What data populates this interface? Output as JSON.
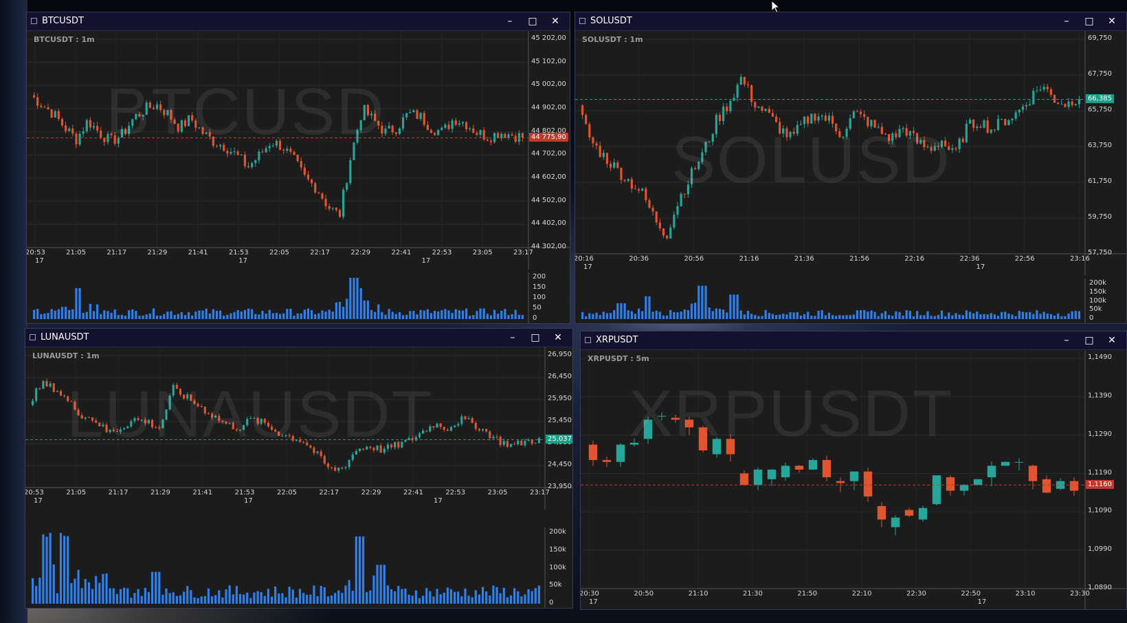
{
  "colors": {
    "up": "#26a69a",
    "down": "#e0552e",
    "volume": "#2f80ed",
    "bg": "#1c1c1c",
    "titlebar": "#14112e"
  },
  "window_controls": {
    "minimize": "–",
    "maximize": "□",
    "close": "✕",
    "icon": "window-menu-icon"
  },
  "windows": [
    {
      "id": "btc",
      "title": "BTCUSDT",
      "label": "BTCUSDT : 1m",
      "watermark": "BTCUSD",
      "price_axis": [
        "45 202,00",
        "45 102,00",
        "45 002,00",
        "44 902,00",
        "44 802,00",
        "44 702,00",
        "44 602,00",
        "44 502,00",
        "44 402,00",
        "44 302,00"
      ],
      "last_price": "44 775,90",
      "last_price_color": "#c0392b",
      "time_axis": [
        "20:53",
        "21:05",
        "21:17",
        "21:29",
        "21:41",
        "21:53",
        "22:05",
        "22:17",
        "22:29",
        "22:41",
        "22:53",
        "23:05",
        "23:17"
      ],
      "time_sub": [
        "17",
        "17",
        "17"
      ],
      "volume_axis": [
        "200",
        "150",
        "100",
        "50",
        "0"
      ]
    },
    {
      "id": "sol",
      "title": "SOLUSDT",
      "label": "SOLUSDT : 1m",
      "watermark": "SOLUSD",
      "price_axis": [
        "69,750",
        "67,750",
        "65,750",
        "63,750",
        "61,750",
        "59,750",
        "57,750"
      ],
      "last_price": "66,385",
      "last_price_color": "#16a085",
      "time_axis": [
        "20:16",
        "20:36",
        "20:56",
        "21:16",
        "21:36",
        "21:56",
        "22:16",
        "22:36",
        "22:56",
        "23:16"
      ],
      "time_sub": [
        "17",
        "17"
      ],
      "volume_axis": [
        "200k",
        "150k",
        "100k",
        "50k",
        "0"
      ]
    },
    {
      "id": "luna",
      "title": "LUNAUSDT",
      "label": "LUNAUSDT : 1m",
      "watermark": "LUNAUSDT",
      "price_axis": [
        "26,950",
        "26,450",
        "25,950",
        "25,450",
        "24,950",
        "24,450",
        "23,950"
      ],
      "last_price": "25,037",
      "last_price_color": "#16a085",
      "time_axis": [
        "20:53",
        "21:05",
        "21:17",
        "21:29",
        "21:41",
        "21:53",
        "22:05",
        "22:17",
        "22:29",
        "22:41",
        "22:53",
        "23:05",
        "23:17"
      ],
      "time_sub": [
        "17",
        "17",
        "17"
      ],
      "volume_axis": [
        "200k",
        "150k",
        "100k",
        "50k",
        "0"
      ]
    },
    {
      "id": "xrp",
      "title": "XRPUSDT",
      "label": "XRPUSDT : 5m",
      "watermark": "XRPUSDT",
      "price_axis": [
        "1,1490",
        "1,1390",
        "1,1290",
        "1,1190",
        "1,1090",
        "1,0990",
        "1,0890"
      ],
      "last_price": "1,1160",
      "last_price_color": "#c0392b",
      "time_axis": [
        "20:30",
        "20:50",
        "21:10",
        "21:30",
        "21:50",
        "22:10",
        "22:30",
        "22:50",
        "23:10",
        "23:30"
      ],
      "time_sub": [
        "17",
        "17"
      ]
    }
  ],
  "chart_data": [
    {
      "type": "candlestick",
      "title": "BTCUSDT : 1m",
      "ylim": [
        44302,
        45202
      ],
      "last": 44775.9,
      "series": [
        {
          "name": "price",
          "anchors": [
            44960,
            44920,
            44880,
            44820,
            44770,
            44850,
            44800,
            44760,
            44790,
            44860,
            44900,
            44920,
            44880,
            44820,
            44860,
            44800,
            44760,
            44740,
            44700,
            44650,
            44700,
            44760,
            44740,
            44680,
            44600,
            44560,
            44480,
            44440,
            44700,
            44900,
            44850,
            44800,
            44820,
            44880,
            44870,
            44820,
            44800,
            44860,
            44840,
            44800,
            44780,
            44800,
            44790,
            44780
          ]
        }
      ]
    },
    {
      "type": "candlestick",
      "title": "SOLUSDT : 1m",
      "ylim": [
        57750,
        69750
      ],
      "last": 66385,
      "series": [
        {
          "name": "price",
          "anchors": [
            65800,
            64000,
            63200,
            62500,
            61800,
            61200,
            59800,
            58800,
            60800,
            62200,
            63500,
            65200,
            66200,
            67600,
            66200,
            65600,
            64800,
            64200,
            65100,
            65600,
            65200,
            64400,
            65600,
            65200,
            64600,
            64200,
            64800,
            64000,
            63600,
            64100,
            63200,
            64800,
            65200,
            64700,
            65200,
            65600,
            66400,
            67200,
            66400,
            66100,
            66600
          ]
        }
      ]
    },
    {
      "type": "candlestick",
      "title": "LUNAUSDT : 1m",
      "ylim": [
        23950,
        26950
      ],
      "last": 25037,
      "series": [
        {
          "name": "price",
          "anchors": [
            25900,
            26300,
            26200,
            25900,
            25600,
            25500,
            25200,
            25300,
            25500,
            25450,
            25300,
            26200,
            26000,
            25800,
            25600,
            25400,
            25300,
            25500,
            25400,
            25200,
            25100,
            25000,
            24700,
            24350,
            24400,
            24800,
            24900,
            24800,
            24900,
            25000,
            25200,
            25400,
            25300,
            25500,
            25400,
            25200,
            25000,
            24900,
            25000,
            25037
          ]
        }
      ]
    },
    {
      "type": "candlestick",
      "title": "XRPUSDT : 5m",
      "ylim": [
        1.089,
        1.149
      ],
      "last": 1.116,
      "series": [
        {
          "name": "price",
          "candles": [
            [
              1.1265,
              1.1225
            ],
            [
              1.1225,
              1.122
            ],
            [
              1.122,
              1.1265
            ],
            [
              1.1265,
              1.127
            ],
            [
              1.128,
              1.133
            ],
            [
              1.134,
              1.134
            ],
            [
              1.1335,
              1.133
            ],
            [
              1.133,
              1.131
            ],
            [
              1.131,
              1.125
            ],
            [
              1.124,
              1.128
            ],
            [
              1.128,
              1.124
            ],
            [
              1.119,
              1.116
            ],
            [
              1.116,
              1.12
            ],
            [
              1.1175,
              1.12
            ],
            [
              1.118,
              1.121
            ],
            [
              1.121,
              1.12
            ],
            [
              1.12,
              1.1225
            ],
            [
              1.1225,
              1.118
            ],
            [
              1.117,
              1.1165
            ],
            [
              1.117,
              1.1195
            ],
            [
              1.1195,
              1.113
            ],
            [
              1.1105,
              1.107
            ],
            [
              1.105,
              1.1075
            ],
            [
              1.1095,
              1.108
            ],
            [
              1.107,
              1.11
            ],
            [
              1.111,
              1.1185
            ],
            [
              1.118,
              1.1145
            ],
            [
              1.1145,
              1.116
            ],
            [
              1.116,
              1.1175
            ],
            [
              1.118,
              1.121
            ],
            [
              1.121,
              1.122
            ],
            [
              1.122,
              1.122
            ],
            [
              1.121,
              1.117
            ],
            [
              1.1175,
              1.114
            ],
            [
              1.115,
              1.117
            ],
            [
              1.117,
              1.1145
            ]
          ]
        }
      ]
    }
  ]
}
